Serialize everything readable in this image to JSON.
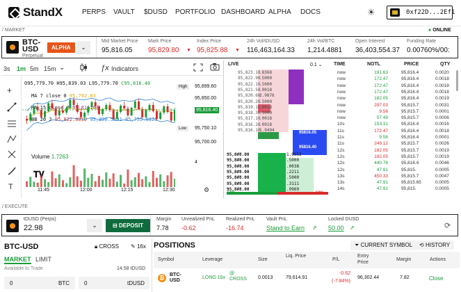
{
  "nav": {
    "brand": "StandX",
    "links": [
      "PERPS",
      "VAULT",
      "$DUSD",
      "PORTFOLIO",
      "DASHBOARD",
      "ALPHA",
      "DOCS"
    ],
    "wallet": "0xf22D...2Ef1"
  },
  "sections": {
    "market": "/ MARKET",
    "online": "ONLINE",
    "execute": "/ EXECUTE"
  },
  "market": {
    "symbol": "BTC-USD",
    "subtitle": "Perpetual",
    "badge": "ALPHA",
    "stats": [
      {
        "label": "Mid Market Price",
        "value": "95,816.05",
        "color": "#111111"
      },
      {
        "label": "Mark Price",
        "value": "95,829.80",
        "color": "#d92b2b",
        "arrow": true
      },
      {
        "label": "Index Price",
        "value": "95,825.88",
        "color": "#d92b2b",
        "arrow": true
      },
      {
        "label": "24h Vol/tDUSD",
        "value": "116,463,164.33",
        "color": "#111111"
      },
      {
        "label": "24h Vol/BTC",
        "value": "1,214.4881",
        "color": "#111111"
      },
      {
        "label": "Open Interest",
        "value": "36,403,554.37",
        "color": "#111111"
      },
      {
        "label": "Funding Rate",
        "value": "0.00760%/00:",
        "color": "#111111"
      }
    ]
  },
  "chart": {
    "timeframes": [
      "3s",
      "1m",
      "5m",
      "15m"
    ],
    "active_tf": "1m",
    "indicators_label": "Indicators",
    "ohlc": {
      "o": "O95,779.70",
      "h": "H95,839.03",
      "l": "L95,779.70",
      "c": "C95,816.40"
    },
    "ma7": {
      "label": "MA 7 close 0",
      "value": "95,792.03"
    },
    "ma15": {
      "label": "MA 15 close 0",
      "value": "95,816.64"
    },
    "bb": {
      "label": "BB 20 2",
      "v1": "95,822.8010",
      "v2": "95,890.5191",
      "v3": "95,755.0829"
    },
    "volume_label": "Volume",
    "volume_value": "1.7263",
    "price_axis": [
      "95,899.60",
      "95,850.00",
      "95,816.40",
      "95,750.10",
      "95,700.00"
    ],
    "price_tags": [
      "High",
      "Low"
    ],
    "vol_axis": "4",
    "time_axis": [
      "11:45",
      "12:00",
      "12:15",
      "12:30"
    ],
    "candles": [
      {
        "o": 95790,
        "h": 95800,
        "l": 95775,
        "c": 95785,
        "v": 1.2
      },
      {
        "o": 95785,
        "h": 95810,
        "l": 95780,
        "c": 95805,
        "v": 2.1
      },
      {
        "o": 95805,
        "h": 95830,
        "l": 95800,
        "c": 95825,
        "v": 1.1
      },
      {
        "o": 95825,
        "h": 95835,
        "l": 95810,
        "c": 95815,
        "v": 0.9
      },
      {
        "o": 95815,
        "h": 95820,
        "l": 95790,
        "c": 95795,
        "v": 2.4
      },
      {
        "o": 95795,
        "h": 95815,
        "l": 95790,
        "c": 95812,
        "v": 1.6
      },
      {
        "o": 95812,
        "h": 95840,
        "l": 95808,
        "c": 95835,
        "v": 1.0
      },
      {
        "o": 95835,
        "h": 95845,
        "l": 95815,
        "c": 95820,
        "v": 3.2
      },
      {
        "o": 95820,
        "h": 95825,
        "l": 95795,
        "c": 95800,
        "v": 1.8
      },
      {
        "o": 95800,
        "h": 95818,
        "l": 95792,
        "c": 95814,
        "v": 2.6
      },
      {
        "o": 95814,
        "h": 95830,
        "l": 95805,
        "c": 95808,
        "v": 1.4
      },
      {
        "o": 95808,
        "h": 95826,
        "l": 95802,
        "c": 95822,
        "v": 0.8
      },
      {
        "o": 95822,
        "h": 95850,
        "l": 95818,
        "c": 95845,
        "v": 2.0
      },
      {
        "o": 95845,
        "h": 95852,
        "l": 95825,
        "c": 95830,
        "v": 4.5
      },
      {
        "o": 95830,
        "h": 95836,
        "l": 95805,
        "c": 95810,
        "v": 2.2
      },
      {
        "o": 95810,
        "h": 95820,
        "l": 95790,
        "c": 95795,
        "v": 1.3
      },
      {
        "o": 95795,
        "h": 95812,
        "l": 95785,
        "c": 95808,
        "v": 3.8
      },
      {
        "o": 95808,
        "h": 95828,
        "l": 95800,
        "c": 95824,
        "v": 1.9
      },
      {
        "o": 95824,
        "h": 95842,
        "l": 95815,
        "c": 95838,
        "v": 2.7
      },
      {
        "o": 95838,
        "h": 95845,
        "l": 95820,
        "c": 95826,
        "v": 1.2
      },
      {
        "o": 95826,
        "h": 95830,
        "l": 95800,
        "c": 95804,
        "v": 2.3
      },
      {
        "o": 95804,
        "h": 95822,
        "l": 95798,
        "c": 95818,
        "v": 1.5
      },
      {
        "o": 95818,
        "h": 95835,
        "l": 95812,
        "c": 95830,
        "v": 3.0
      },
      {
        "o": 95830,
        "h": 95838,
        "l": 95810,
        "c": 95815,
        "v": 1.7
      },
      {
        "o": 95815,
        "h": 95820,
        "l": 95785,
        "c": 95790,
        "v": 2.8
      },
      {
        "o": 95790,
        "h": 95815,
        "l": 95785,
        "c": 95810,
        "v": 1.1
      },
      {
        "o": 95810,
        "h": 95832,
        "l": 95805,
        "c": 95828,
        "v": 2.5
      },
      {
        "o": 95828,
        "h": 95840,
        "l": 95815,
        "c": 95820,
        "v": 0.7
      },
      {
        "o": 95820,
        "h": 95826,
        "l": 95795,
        "c": 95800,
        "v": 3.6
      },
      {
        "o": 95800,
        "h": 95825,
        "l": 95797,
        "c": 95822,
        "v": 1.4
      },
      {
        "o": 95822,
        "h": 95845,
        "l": 95818,
        "c": 95840,
        "v": 2.0
      },
      {
        "o": 95840,
        "h": 95848,
        "l": 95815,
        "c": 95818,
        "v": 2.9
      },
      {
        "o": 95818,
        "h": 95825,
        "l": 95790,
        "c": 95795,
        "v": 1.6
      },
      {
        "o": 95795,
        "h": 95820,
        "l": 95792,
        "c": 95816,
        "v": 2.2
      },
      {
        "o": 95816,
        "h": 95835,
        "l": 95810,
        "c": 95830,
        "v": 1.0
      },
      {
        "o": 95830,
        "h": 95838,
        "l": 95808,
        "c": 95812,
        "v": 3.3
      },
      {
        "o": 95812,
        "h": 95818,
        "l": 95785,
        "c": 95790,
        "v": 1.9
      },
      {
        "o": 95790,
        "h": 95812,
        "l": 95786,
        "c": 95808,
        "v": 2.6
      },
      {
        "o": 95808,
        "h": 95830,
        "l": 95802,
        "c": 95826,
        "v": 1.2
      },
      {
        "o": 95826,
        "h": 95834,
        "l": 95805,
        "c": 95810,
        "v": 2.4
      },
      {
        "o": 95810,
        "h": 95820,
        "l": 95780,
        "c": 95785,
        "v": 3.1
      },
      {
        "o": 95785,
        "h": 95822,
        "l": 95780,
        "c": 95816,
        "v": 1.7
      }
    ]
  },
  "book": {
    "tabs": [
      "LIVE",
      "0.1"
    ],
    "asks": [
      {
        "p": "95,823.10",
        "s": ".8368"
      },
      {
        "p": "95,822.90",
        "s": ".5000"
      },
      {
        "p": "95,822.10",
        "s": ".5000"
      },
      {
        "p": "95,821.50",
        "s": ".0018"
      },
      {
        "p": "95,820.60",
        "s": "2.9876"
      },
      {
        "p": "95,820.20",
        "s": ".5000"
      },
      {
        "p": "95,819.10",
        "s": ".0018"
      },
      {
        "p": "95,818.30",
        "s": ".5000"
      },
      {
        "p": "95,817.10",
        "s": ".0018"
      },
      {
        "p": "95,816.20",
        "s": ".0018"
      },
      {
        "p": "95,816.10",
        "s": "1.9494"
      }
    ],
    "mid_tags": [
      "95816.05",
      "95816.40"
    ],
    "bids": [
      {
        "p": "95,8#8.00",
        "s": "1.0553"
      },
      {
        "p": "95,8#8.00",
        "s": ".5000"
      },
      {
        "p": "95,8#8.00",
        "s": ".0038"
      },
      {
        "p": "95,8#8.00",
        "s": ".2211"
      },
      {
        "p": "95,8#8.00",
        "s": ".5000"
      },
      {
        "p": "95,8#8.00",
        "s": ".3111"
      },
      {
        "p": "95,8#8.00",
        "s": ".9969"
      }
    ],
    "ratio_left": "50%",
    "ratio_right": "50%"
  },
  "trades": {
    "headers": [
      "TIME",
      "NOTL",
      "PRICE",
      "QTY"
    ],
    "rows": [
      {
        "t": "now",
        "n": "191.63",
        "p": "95,816.4",
        "q": "0.0020",
        "c": "green"
      },
      {
        "t": "now",
        "n": "172.47",
        "p": "95,816.4",
        "q": "0.0018",
        "c": "green"
      },
      {
        "t": "now",
        "n": "172.47",
        "p": "95,816.4",
        "q": "0.0018",
        "c": "green"
      },
      {
        "t": "now",
        "n": "172.47",
        "p": "95,816.4",
        "q": "0.0018",
        "c": "green"
      },
      {
        "t": "now",
        "n": "182.05",
        "p": "95,816.4",
        "q": "0.0019",
        "c": "green"
      },
      {
        "t": "now",
        "n": "297.03",
        "p": "95,815.7",
        "q": "0.0031",
        "c": "red"
      },
      {
        "t": "now",
        "n": "9.58",
        "p": "95,815.7",
        "q": "0.0001",
        "c": "red"
      },
      {
        "t": "now",
        "n": "57.49",
        "p": "95,815.7",
        "q": "0.0006",
        "c": "green"
      },
      {
        "t": "10s",
        "n": "153.31",
        "p": "95,816.4",
        "q": "0.0016",
        "c": "green"
      },
      {
        "t": "11s",
        "n": "172.47",
        "p": "95,816.4",
        "q": "0.0018",
        "c": "red"
      },
      {
        "t": "11s",
        "n": "9.58",
        "p": "95,816.4",
        "q": "0.0001",
        "c": "green"
      },
      {
        "t": "11s",
        "n": "249.12",
        "p": "95,815.7",
        "q": "0.0026",
        "c": "red"
      },
      {
        "t": "12s",
        "n": "182.05",
        "p": "95,815.7",
        "q": "0.0019",
        "c": "red"
      },
      {
        "t": "12s",
        "n": "182.05",
        "p": "95,815.7",
        "q": "0.0019",
        "c": "red"
      },
      {
        "t": "12s",
        "n": "440.76",
        "p": "95,816.4",
        "q": "0.0046",
        "c": "green"
      },
      {
        "t": "12s",
        "n": "47.91",
        "p": "95,815.",
        "q": "0.0005",
        "c": "green"
      },
      {
        "t": "13s",
        "n": "450.33",
        "p": "95,815.7",
        "q": "0.0047",
        "c": "red"
      },
      {
        "t": "13s",
        "n": "47.91",
        "p": "95,815.65",
        "q": "0.0005",
        "c": "green"
      },
      {
        "t": "14s",
        "n": "47.91",
        "p": "95,815.",
        "q": "0.0005",
        "c": "green"
      }
    ]
  },
  "execute": {
    "asset_label": "tDUSD (Perps)",
    "asset_value": "22.98",
    "deposit_label": "DEPOSIT",
    "stats": [
      {
        "label": "Margin",
        "value": "7.78",
        "color": "#111111"
      },
      {
        "label": "Unrealized PnL",
        "value": "-0.62",
        "color": "#d92b2b"
      },
      {
        "label": "Realized PnL",
        "value": "-16.74",
        "color": "#d92b2b"
      },
      {
        "label": "Vault PnL",
        "value": "Stand to Earn",
        "color": "#1a9c3a"
      },
      {
        "label": "Locked DUSD",
        "value": "50.00",
        "color": "#1a9c3a"
      }
    ]
  },
  "order": {
    "symbol": "BTC-USD",
    "margin_mode": "CROSS",
    "leverage": "16x",
    "tabs": [
      "MARKET",
      "LIMIT"
    ],
    "available_label": "Available to Trade",
    "available_value": "14.58 tDUSD",
    "qty_value": "0",
    "qty_unit": "BTC",
    "amt_value": "0",
    "amt_unit": "tDUSD"
  },
  "positions": {
    "title": "POSITIONS",
    "filter_label": "CURRENT SYMBOL",
    "history_label": "HISTORY",
    "headers": [
      "Symbol",
      "Leverage",
      "Size",
      "Liq. Price",
      "P/L",
      "Entry Price",
      "Margin",
      "Actions"
    ],
    "row": {
      "symbol": "BTC-USD",
      "leverage": "LONG 16x",
      "mode": "@ CROSS",
      "size": "0.0013",
      "liq": "79,614.91",
      "pl": "-0.62",
      "pl_pct": "(-7.84%)",
      "entry": "96,302.44",
      "margin": "7.82",
      "action": "Close"
    }
  }
}
